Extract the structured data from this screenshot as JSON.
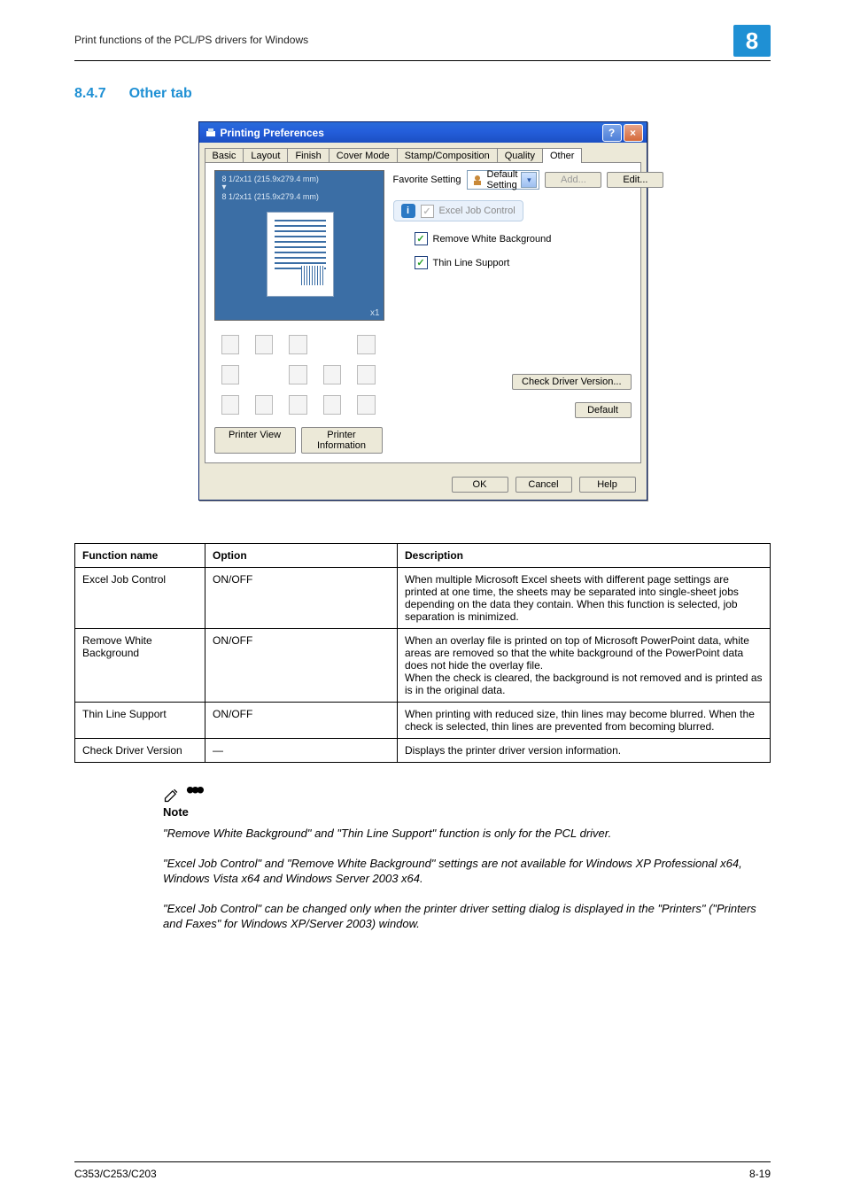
{
  "header": {
    "breadcrumb": "Print functions of the PCL/PS drivers for Windows",
    "chapter": "8"
  },
  "heading": {
    "number": "8.4.7",
    "title": "Other tab"
  },
  "dialog": {
    "title": "Printing Preferences",
    "tabs": [
      "Basic",
      "Layout",
      "Finish",
      "Cover Mode",
      "Stamp/Composition",
      "Quality",
      "Other"
    ],
    "active_tab_index": 6,
    "preview": {
      "line1": "8 1/2x11 (215.9x279.4 mm)",
      "line2": "8 1/2x11 (215.9x279.4 mm)",
      "badge": "x1"
    },
    "preview_buttons": {
      "view": "Printer View",
      "info": "Printer Information"
    },
    "favorite": {
      "label": "Favorite Setting",
      "selected": "Default Setting",
      "add": "Add...",
      "edit": "Edit..."
    },
    "excel_job_control": "Excel Job Control",
    "checkboxes": {
      "remove_white_bg": "Remove White Background",
      "thin_line": "Thin Line Support"
    },
    "check_driver_btn": "Check Driver Version...",
    "default_btn": "Default",
    "bottom": {
      "ok": "OK",
      "cancel": "Cancel",
      "help": "Help"
    }
  },
  "table": {
    "headers": {
      "fn": "Function name",
      "op": "Option",
      "desc": "Description"
    },
    "rows": [
      {
        "fn": "Excel Job Control",
        "op": "ON/OFF",
        "desc": "When multiple Microsoft Excel sheets with different page settings are printed at one time, the sheets may be separated into single-sheet jobs depending on the data they contain. When this function is selected, job separation is minimized."
      },
      {
        "fn": "Remove White Background",
        "op": "ON/OFF",
        "desc": "When an overlay file is printed on top of Microsoft PowerPoint data, white areas are removed so that the white background of the PowerPoint data does not hide the overlay file.\nWhen the check is cleared, the background is not removed and is printed as is in the original data."
      },
      {
        "fn": "Thin Line Support",
        "op": "ON/OFF",
        "desc": "When printing with reduced size, thin lines may become blurred. When the check is selected, thin lines are prevented from becoming blurred."
      },
      {
        "fn": "Check Driver Version",
        "op": "—",
        "desc": "Displays the printer driver version information."
      }
    ]
  },
  "note": {
    "title": "Note",
    "paragraphs": [
      "\"Remove White Background\" and \"Thin Line Support\" function is only for the PCL driver.",
      "\"Excel Job Control\" and \"Remove White Background\" settings are not available for Windows XP Professional x64, Windows Vista x64 and Windows Server 2003 x64.",
      "\"Excel Job Control\" can be changed only when the printer driver setting dialog is displayed in the \"Printers\" (\"Printers and Faxes\" for Windows XP/Server 2003) window."
    ]
  },
  "footer": {
    "model": "C353/C253/C203",
    "page": "8-19"
  }
}
